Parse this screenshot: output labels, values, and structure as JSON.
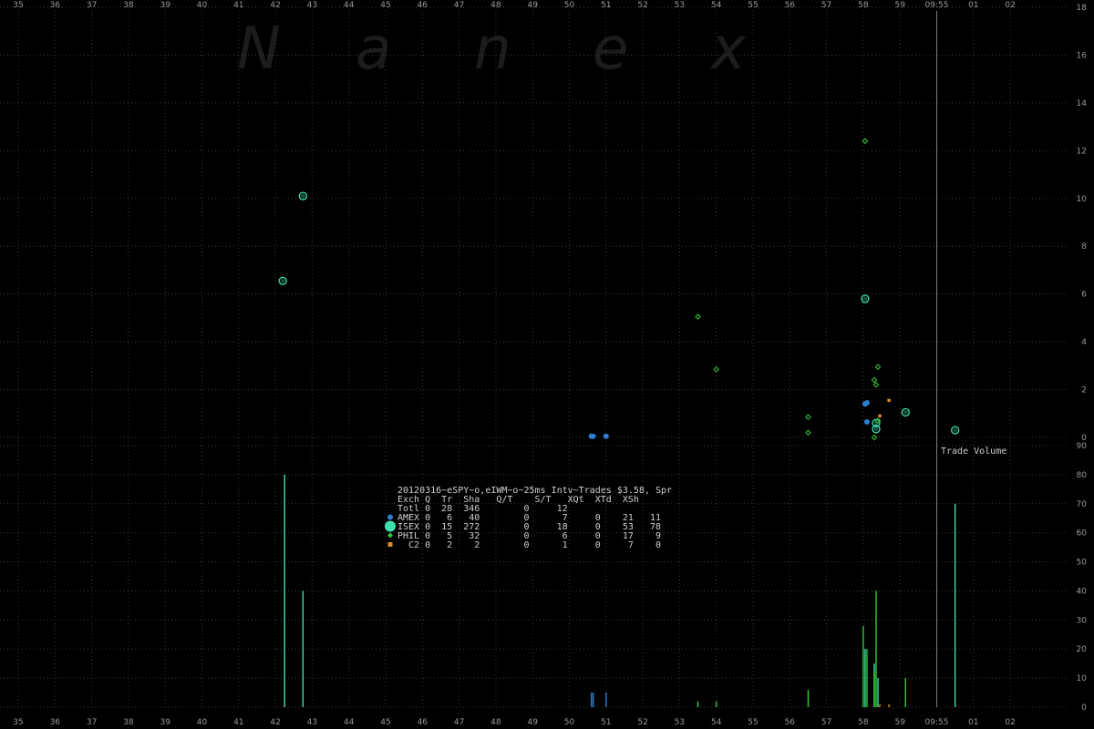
{
  "watermark": [
    "N",
    "a",
    "n",
    "e",
    "x"
  ],
  "colors": {
    "background": "#000000",
    "grid": "#3a3a3a",
    "tick": "#9a9a9a",
    "divider": "#7a7a7a",
    "AMEX": "#2f7fd0",
    "ISEX": "#3fe0b0",
    "PHIL": "#33cc33",
    "C2": "#e08a20"
  },
  "chart_data": [
    {
      "type": "scatter",
      "title": "",
      "x_tick_labels": [
        "35",
        "36",
        "37",
        "38",
        "39",
        "40",
        "41",
        "42",
        "43",
        "44",
        "45",
        "46",
        "47",
        "48",
        "49",
        "50",
        "51",
        "52",
        "53",
        "54",
        "55",
        "56",
        "57",
        "58",
        "59",
        "09:55",
        "01",
        "02"
      ],
      "y_ticks": [
        0,
        2,
        4,
        6,
        8,
        10,
        12,
        14,
        16,
        18
      ],
      "ylim": [
        0,
        18
      ],
      "grid": true,
      "series": [
        {
          "name": "AMEX",
          "marker": "dot",
          "points": [
            [
              50.6,
              0.05
            ],
            [
              50.65,
              0.05
            ],
            [
              51.0,
              0.05
            ],
            [
              58.05,
              1.4
            ],
            [
              58.1,
              1.45
            ],
            [
              58.1,
              0.65
            ]
          ]
        },
        {
          "name": "ISEX",
          "marker": "ring",
          "points": [
            [
              42.2,
              6.55
            ],
            [
              42.75,
              10.1
            ],
            [
              58.05,
              5.8
            ],
            [
              58.35,
              0.6
            ],
            [
              58.35,
              0.35
            ],
            [
              59.15,
              1.05
            ],
            [
              60.5,
              0.3
            ]
          ]
        },
        {
          "name": "PHIL",
          "marker": "diamond",
          "points": [
            [
              53.5,
              5.05
            ],
            [
              54.0,
              2.85
            ],
            [
              56.5,
              0.85
            ],
            [
              56.5,
              0.2
            ],
            [
              58.05,
              12.4
            ],
            [
              58.3,
              2.4
            ],
            [
              58.35,
              2.2
            ],
            [
              58.4,
              2.95
            ],
            [
              58.3,
              0.0
            ],
            [
              58.4,
              0.7
            ]
          ]
        },
        {
          "name": "C2",
          "marker": "square",
          "points": [
            [
              58.45,
              0.9
            ],
            [
              58.7,
              1.55
            ]
          ]
        }
      ],
      "annotation": "Trade Volume"
    },
    {
      "type": "bar",
      "title": "",
      "x_tick_labels": [
        "35",
        "36",
        "37",
        "38",
        "39",
        "40",
        "41",
        "42",
        "43",
        "44",
        "45",
        "46",
        "47",
        "48",
        "49",
        "50",
        "51",
        "52",
        "53",
        "54",
        "55",
        "56",
        "57",
        "58",
        "59",
        "09:55",
        "01",
        "02"
      ],
      "y_ticks": [
        0,
        10,
        20,
        30,
        40,
        50,
        60,
        70,
        80,
        90
      ],
      "ylim": [
        0,
        90
      ],
      "grid": true,
      "series": [
        {
          "name": "AMEX",
          "bars": [
            [
              50.6,
              5
            ],
            [
              50.65,
              5
            ],
            [
              51.0,
              5
            ]
          ]
        },
        {
          "name": "ISEX",
          "bars": [
            [
              42.25,
              80
            ],
            [
              42.75,
              40
            ],
            [
              58.05,
              20
            ],
            [
              58.3,
              15
            ],
            [
              58.4,
              10
            ],
            [
              60.5,
              70
            ]
          ]
        },
        {
          "name": "PHIL",
          "bars": [
            [
              53.5,
              2
            ],
            [
              54.0,
              2
            ],
            [
              56.5,
              6
            ],
            [
              58.0,
              28
            ],
            [
              58.1,
              20
            ],
            [
              58.3,
              12
            ],
            [
              58.35,
              40
            ],
            [
              59.15,
              10
            ]
          ]
        },
        {
          "name": "C2",
          "bars": [
            [
              58.45,
              1
            ],
            [
              58.7,
              1
            ]
          ]
        }
      ]
    }
  ],
  "legend": {
    "header": "20120316~eSPY~o,eIWM~o~25ms Intv~Trades $3.58, Spr",
    "columns": "Exch Q  Tr  Sha   Q/T    S/T   XQt  XTd  XSh",
    "rows": [
      {
        "label": "Totl 0  28  346        0     12",
        "marker": "none",
        "color": ""
      },
      {
        "label": "AMEX 0   6   40        0      7     0    21   11",
        "marker": "dot",
        "color": "#2f7fd0"
      },
      {
        "label": "ISEX 0  15  272        0     18     0    53   78",
        "marker": "bigdot",
        "color": "#3fe0b0"
      },
      {
        "label": "PHIL 0   5   32        0      6     0    17    9",
        "marker": "diamond",
        "color": "#33cc33"
      },
      {
        "label": "  C2 0   2    2        0      1     0     7    0",
        "marker": "square",
        "color": "#e08a20"
      }
    ]
  }
}
